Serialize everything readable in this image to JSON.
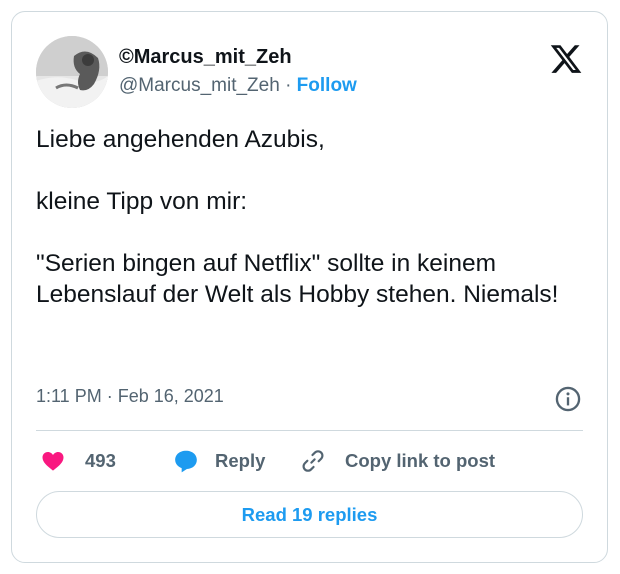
{
  "author": {
    "display_name": "©Marcus_mit_Zeh",
    "handle": "@Marcus_mit_Zeh",
    "separator": "·",
    "follow_label": "Follow"
  },
  "tweet": {
    "text": "Liebe angehenden Azubis,\n\nkleine Tipp von mir:\n\n\"Serien bingen auf Netflix\" sollte in keinem Lebenslauf der Welt als Hobby stehen. Niemals!",
    "time": "1:11 PM",
    "dot": "·",
    "date": "Feb 16, 2021"
  },
  "actions": {
    "like_count": "493",
    "reply_label": "Reply",
    "copy_label": "Copy link to post"
  },
  "read_replies_label": "Read 19 replies",
  "colors": {
    "like": "#f91880",
    "accent": "#1d9bf0",
    "muted": "#536471"
  },
  "icons": {
    "brand": "x-logo-icon",
    "info": "info-icon",
    "like": "heart-icon",
    "reply": "reply-bubble-icon",
    "copy": "link-icon"
  }
}
